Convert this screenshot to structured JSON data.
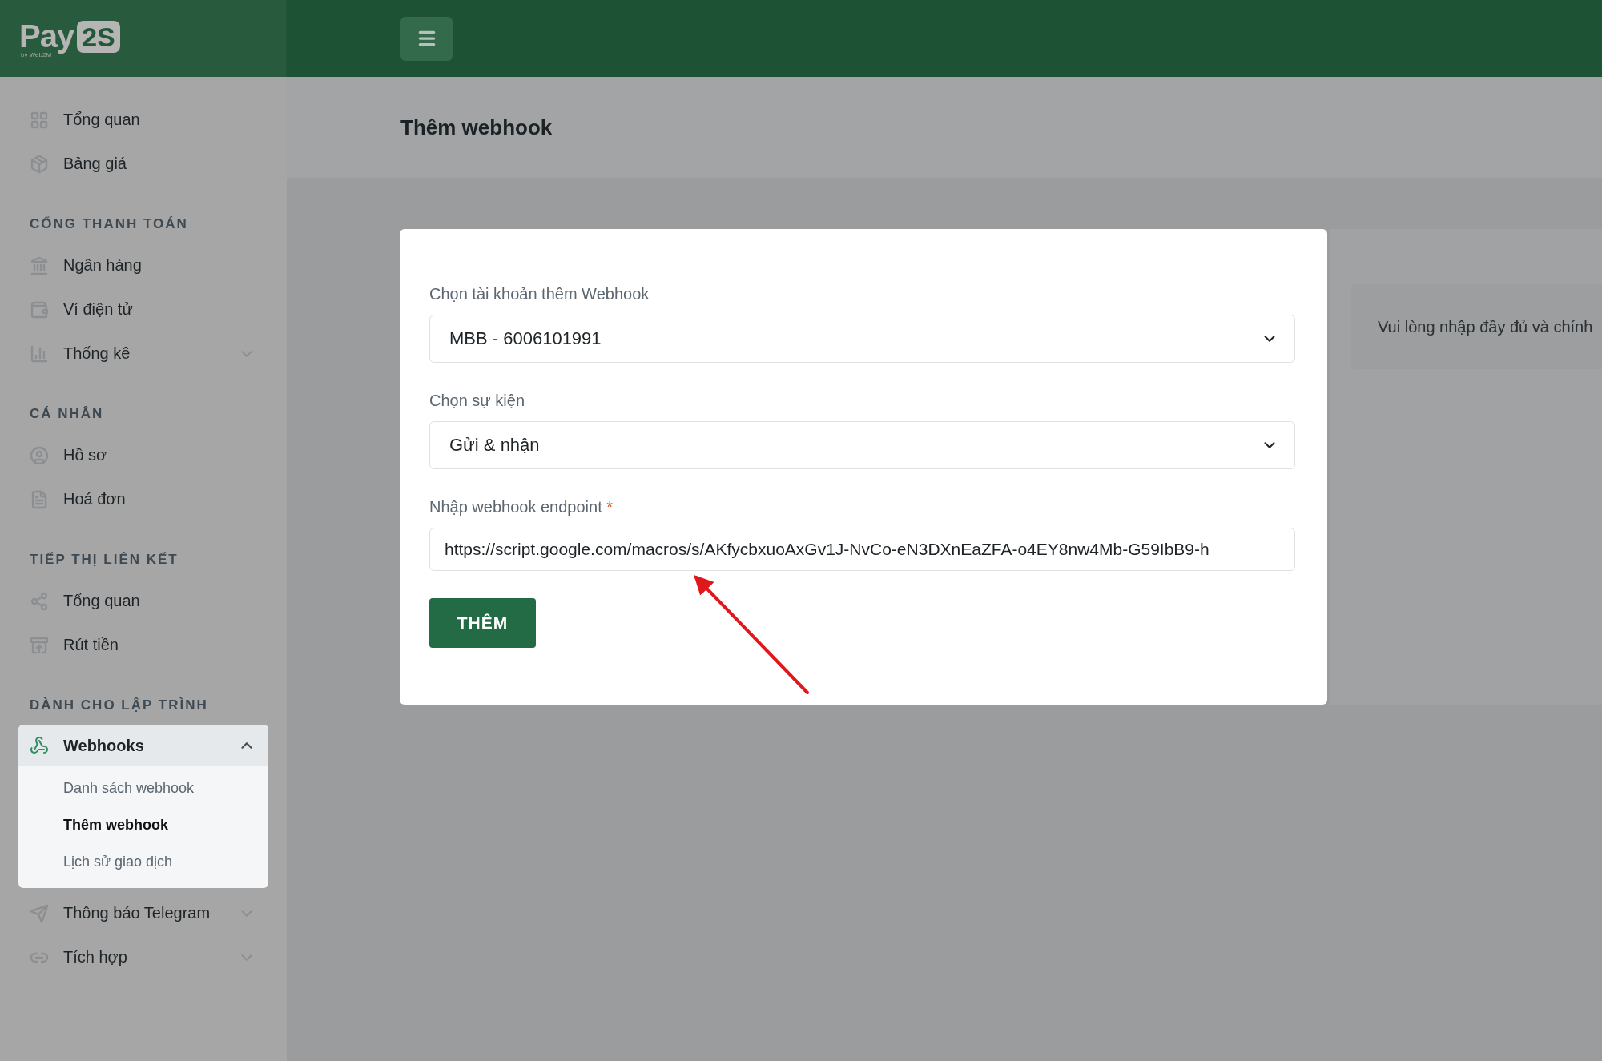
{
  "logo": {
    "text": "Pay",
    "badge": "2S",
    "tagline": "by Web2M"
  },
  "sidebar": {
    "sections": [
      {
        "items": [
          {
            "label": "Tổng quan",
            "selected": false
          },
          {
            "label": "Bảng giá",
            "selected": false
          }
        ]
      },
      {
        "heading": "CỔNG THANH TOÁN",
        "items": [
          {
            "label": "Ngân hàng",
            "selected": false
          },
          {
            "label": "Ví điện tử",
            "selected": false
          },
          {
            "label": "Thống kê",
            "expanded": false,
            "selected": false
          }
        ]
      },
      {
        "heading": "CÁ NHÂN",
        "items": [
          {
            "label": "Hồ sơ",
            "selected": false
          },
          {
            "label": "Hoá đơn",
            "selected": false
          }
        ]
      },
      {
        "heading": "TIẾP THỊ LIÊN KẾT",
        "items": [
          {
            "label": "Tổng quan",
            "selected": false
          },
          {
            "label": "Rút tiền",
            "selected": false
          }
        ]
      },
      {
        "heading": "DÀNH CHO LẬP TRÌNH",
        "items": [
          {
            "label": "Webhooks",
            "expanded": true,
            "selected": true,
            "children": [
              {
                "label": "Danh sách webhook",
                "selected": false
              },
              {
                "label": "Thêm webhook",
                "selected": true
              },
              {
                "label": "Lịch sử giao dịch",
                "selected": false
              }
            ]
          },
          {
            "label": "Thông báo Telegram",
            "expanded": false,
            "selected": false
          },
          {
            "label": "Tích hợp",
            "expanded": false,
            "selected": false
          }
        ]
      }
    ]
  },
  "page": {
    "title": "Thêm webhook"
  },
  "form": {
    "fields": [
      {
        "kind": "select",
        "label": "Chọn tài khoản thêm Webhook",
        "value": "MBB - 6006101991"
      },
      {
        "kind": "select",
        "label": "Chọn sự kiện",
        "value": "Gửi & nhận"
      },
      {
        "kind": "text",
        "label": "Nhập webhook endpoint",
        "required": true,
        "value": "https://script.google.com/macros/s/AKfycbxuoAxGv1J-NvCo-eN3DXnEaZFA-o4EY8nw4Mb-G59IbB9-h"
      }
    ],
    "required_mark": "*",
    "submit": "THÊM"
  },
  "notice": {
    "text": "Vui lòng nhập đầy đủ và chính"
  }
}
